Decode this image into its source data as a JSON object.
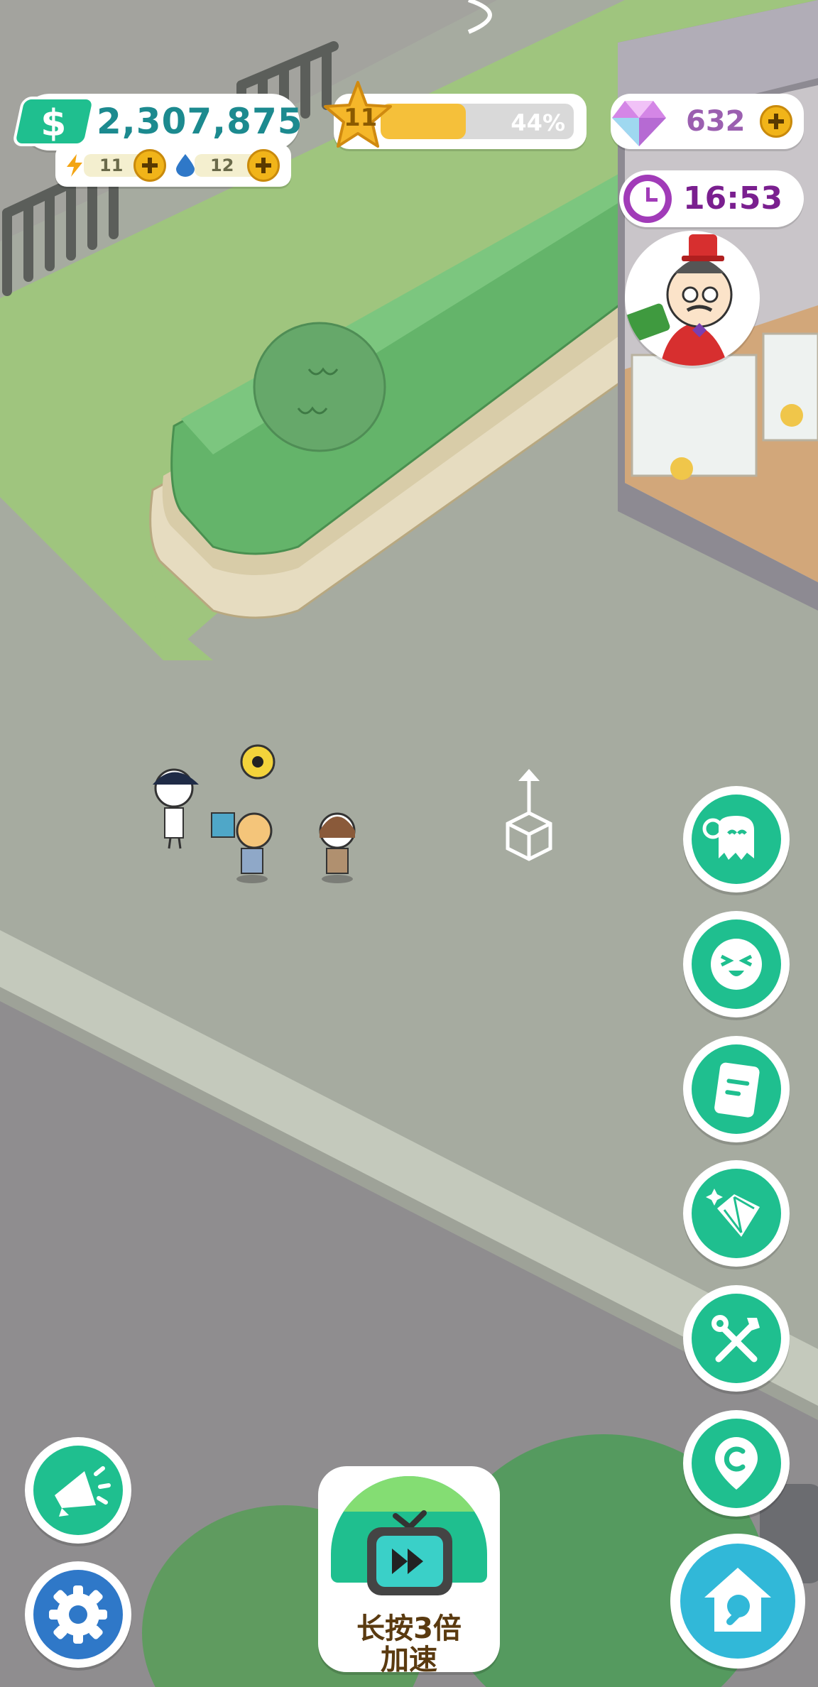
{
  "hud": {
    "cash": "2,307,875",
    "energy": "11",
    "water": "12",
    "level": "11",
    "progress_label": "44%",
    "progress_value": 0.44,
    "gems": "632",
    "timer": "16:53"
  },
  "speed_button": {
    "line1": "长按3倍",
    "line2": "加速"
  },
  "colors": {
    "accent_green": "#1fbf8f",
    "cash_teal": "#1c8a8f",
    "gold": "#f1b419",
    "purple": "#7a1f8f",
    "settings_blue": "#2f78c8",
    "repair_cyan": "#31b8d8"
  },
  "icons": {
    "right_column": [
      "chat-ghost-icon",
      "smiley-icon",
      "notes-icon",
      "gem-shop-icon",
      "tools-icon",
      "coin-location-icon",
      "home-repair-icon"
    ],
    "left_column": [
      "megaphone-icon",
      "settings-gear-icon"
    ],
    "center": "tv-fast-forward-icon"
  }
}
